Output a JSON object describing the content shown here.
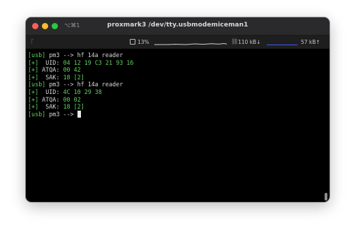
{
  "window": {
    "shortcut": "⌥⌘1",
    "title": "proxmark3 /dev/tty.usbmodemiceman1"
  },
  "statusbar": {
    "branch_icon": "git-branch-icon",
    "cpu_icon": "cpu-icon",
    "cpu_percent": "13%",
    "net_icon": "network-icon",
    "net_down": "110 kB↓",
    "net_up": "57 kB↑"
  },
  "colors": {
    "prompt_green": "#5fd35f",
    "text": "#d6d6d6",
    "background": "#000000"
  },
  "terminal": {
    "lines": [
      {
        "segments": [
          {
            "t": "[usb]",
            "c": "g"
          },
          {
            "t": " pm3 --> hf 14a reader",
            "c": ""
          }
        ]
      },
      {
        "segments": [
          {
            "t": "[+]",
            "c": "g"
          },
          {
            "t": "  UID: ",
            "c": ""
          },
          {
            "t": "04 12 19 C3 21 93 16",
            "c": "g"
          }
        ]
      },
      {
        "segments": [
          {
            "t": "[+]",
            "c": "g"
          },
          {
            "t": " ATQA: ",
            "c": ""
          },
          {
            "t": "00 42",
            "c": "g"
          }
        ]
      },
      {
        "segments": [
          {
            "t": "[+]",
            "c": "g"
          },
          {
            "t": "  SAK: ",
            "c": ""
          },
          {
            "t": "18 [2]",
            "c": "g"
          }
        ]
      },
      {
        "segments": [
          {
            "t": "[usb]",
            "c": "g"
          },
          {
            "t": " pm3 --> hf 14a reader",
            "c": ""
          }
        ]
      },
      {
        "segments": [
          {
            "t": "[+]",
            "c": "g"
          },
          {
            "t": "  UID: ",
            "c": ""
          },
          {
            "t": "4C 10 29 38",
            "c": "g"
          }
        ]
      },
      {
        "segments": [
          {
            "t": "[+]",
            "c": "g"
          },
          {
            "t": " ATQA: ",
            "c": ""
          },
          {
            "t": "00 02",
            "c": "g"
          }
        ]
      },
      {
        "segments": [
          {
            "t": "[+]",
            "c": "g"
          },
          {
            "t": "  SAK: ",
            "c": ""
          },
          {
            "t": "18 [2]",
            "c": "g"
          }
        ]
      },
      {
        "segments": [
          {
            "t": "[usb]",
            "c": "g"
          },
          {
            "t": " pm3 --> ",
            "c": ""
          }
        ],
        "cursor": true
      }
    ]
  }
}
